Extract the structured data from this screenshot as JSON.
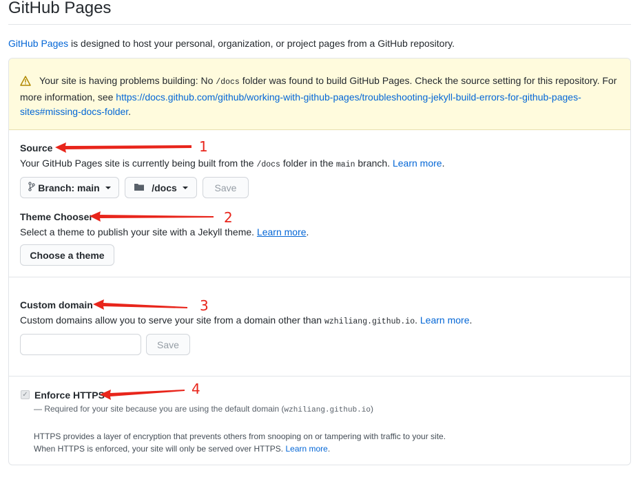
{
  "title": "GitHub Pages",
  "intro": {
    "link": "GitHub Pages",
    "text": " is designed to host your personal, organization, or project pages from a GitHub repository."
  },
  "warning": {
    "icon": "alert-icon",
    "text": "Your site is having problems building: No ",
    "code": "/docs",
    "text2": " folder was found to build GitHub Pages. Check the source setting for this repository. For more information, see ",
    "link": "https://docs.github.com/github/working-with-github-pages/troubleshooting-jekyll-build-errors-for-github-pages-sites#missing-docs-folder",
    "end": "."
  },
  "source": {
    "heading": "Source",
    "desc_a": "Your GitHub Pages site is currently being built from the ",
    "folder_code": "/docs",
    "desc_b": " folder in the ",
    "branch_code": "main",
    "desc_c": " branch. ",
    "learn_more": "Learn more",
    "end": ".",
    "branch_button": "Branch: main",
    "folder_button": "/docs",
    "save_button": "Save"
  },
  "theme": {
    "heading": "Theme Chooser",
    "desc": "Select a theme to publish your site with a Jekyll theme. ",
    "learn_more": "Learn more",
    "end": ".",
    "button": "Choose a theme"
  },
  "custom_domain": {
    "heading": "Custom domain",
    "desc_a": "Custom domains allow you to serve your site from a domain other than ",
    "domain_code": "wzhiliang.github.io",
    "desc_b": ". ",
    "learn_more": "Learn more",
    "end": ".",
    "input_value": "",
    "save_button": "Save"
  },
  "https": {
    "label": "Enforce HTTPS",
    "checked": true,
    "required_a": "— Required for your site because you are using the default domain (",
    "required_code": "wzhiliang.github.io",
    "required_b": ")",
    "info_line1": "HTTPS provides a layer of encryption that prevents others from snooping on or tampering with traffic to your site.",
    "info_line2": "When HTTPS is enforced, your site will only be served over HTTPS. ",
    "learn_more": "Learn more",
    "end": "."
  },
  "annotations": {
    "color": "#e8251b",
    "labels": [
      "1",
      "2",
      "3",
      "4"
    ]
  },
  "colors": {
    "link": "#0366d6",
    "warning_bg": "#fffbdd",
    "border": "#e1e4e8"
  }
}
